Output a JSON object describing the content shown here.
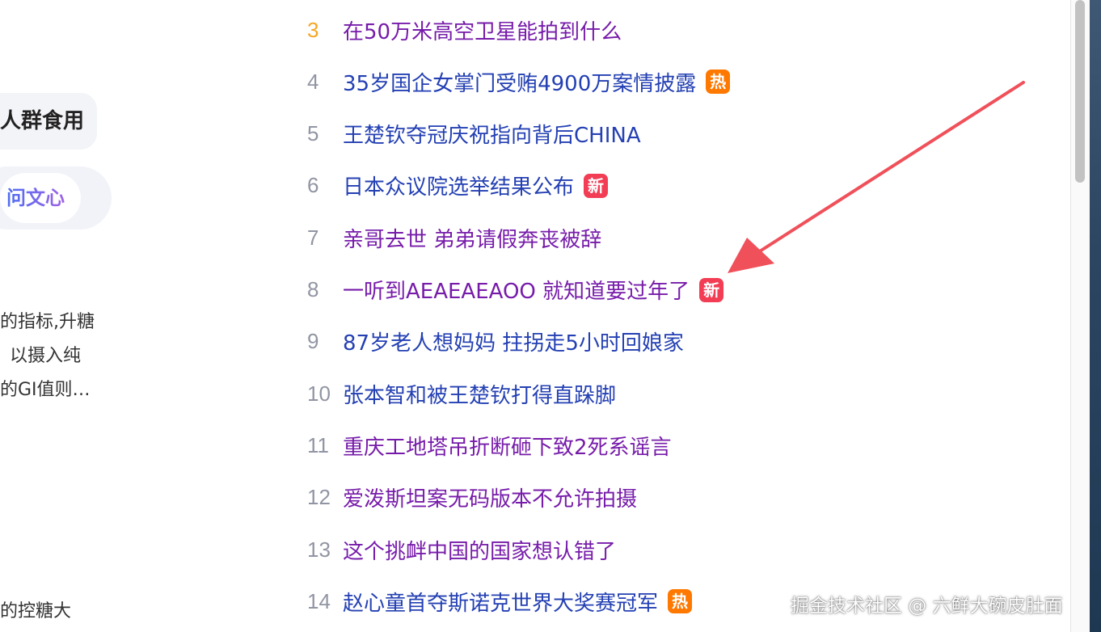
{
  "left_panel": {
    "chip_1": "人群食用",
    "chip_2": "问文心",
    "desc_lines": [
      "的指标,升糖",
      "以摄入纯",
      "的GI值则…",
      "的控糖大"
    ]
  },
  "hot_list": [
    {
      "rank": "3",
      "title": "在50万米高空卫星能拍到什么",
      "badge": null,
      "visited": true
    },
    {
      "rank": "4",
      "title": "35岁国企女掌门受贿4900万案情披露",
      "badge": "热",
      "badge_type": "hot",
      "visited": false
    },
    {
      "rank": "5",
      "title": "王楚钦夺冠庆祝指向背后CHINA",
      "badge": null,
      "visited": false
    },
    {
      "rank": "6",
      "title": "日本众议院选举结果公布",
      "badge": "新",
      "badge_type": "new",
      "visited": false
    },
    {
      "rank": "7",
      "title": "亲哥去世 弟弟请假奔丧被辞",
      "badge": null,
      "visited": true
    },
    {
      "rank": "8",
      "title": "一听到AEAEAEAOO 就知道要过年了",
      "badge": "新",
      "badge_type": "new",
      "visited": true
    },
    {
      "rank": "9",
      "title": "87岁老人想妈妈 拄拐走5小时回娘家",
      "badge": null,
      "visited": false
    },
    {
      "rank": "10",
      "title": "张本智和被王楚钦打得直跺脚",
      "badge": null,
      "visited": false
    },
    {
      "rank": "11",
      "title": "重庆工地塔吊折断砸下致2死系谣言",
      "badge": null,
      "visited": true
    },
    {
      "rank": "12",
      "title": "爱泼斯坦案无码版本不允许拍摄",
      "badge": null,
      "visited": true
    },
    {
      "rank": "13",
      "title": "这个挑衅中国的国家想认错了",
      "badge": null,
      "visited": true
    },
    {
      "rank": "14",
      "title": "赵心童首夺斯诺克世界大奖赛冠军",
      "badge": "热",
      "badge_type": "hot",
      "visited": false
    }
  ],
  "colors": {
    "link": "#2440b3",
    "visited": "#771caa",
    "rank_top": "#f5a623",
    "rank": "#9195a3",
    "badge_hot": "#ff7800",
    "badge_new": "#f23d55",
    "arrow": "#f0505a"
  },
  "watermark": "掘金技术社区 @ 六鲜大碗皮肚面"
}
